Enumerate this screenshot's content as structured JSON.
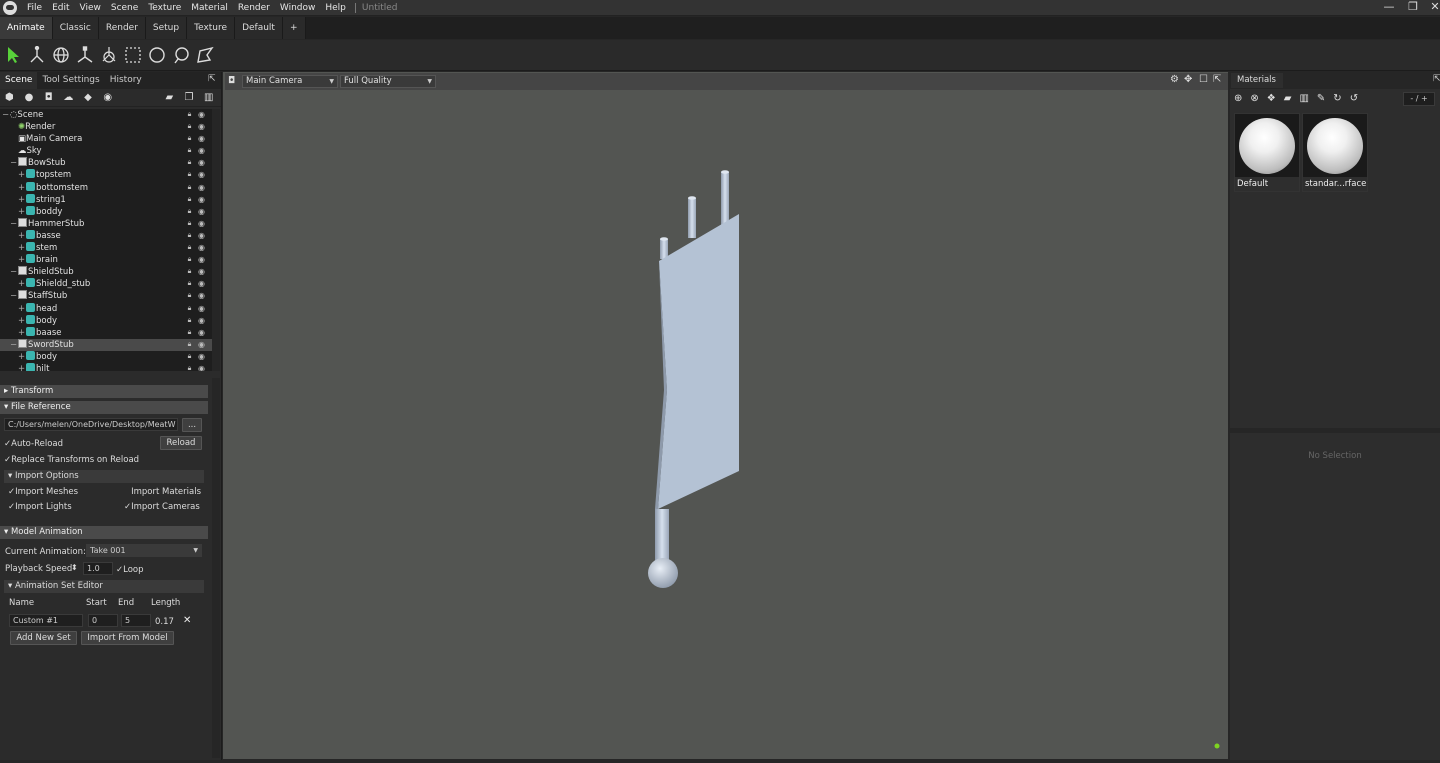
{
  "menu": {
    "items": [
      "File",
      "Edit",
      "View",
      "Scene",
      "Texture",
      "Material",
      "Render",
      "Window",
      "Help"
    ],
    "document_title": "Untitled"
  },
  "window_controls": {
    "minimize": "—",
    "restore": "❐",
    "close": "✕"
  },
  "workspace_tabs": [
    "Animate",
    "Classic",
    "Render",
    "Setup",
    "Texture",
    "Default",
    "+"
  ],
  "left_panel": {
    "tabs": [
      "Scene",
      "Tool Settings",
      "History"
    ],
    "tree": [
      {
        "label": "Scene",
        "icon": "scene",
        "indent": 0,
        "expander": "−"
      },
      {
        "label": "Render",
        "icon": "render",
        "indent": 1,
        "expander": ""
      },
      {
        "label": "Main Camera",
        "icon": "camera",
        "indent": 1,
        "expander": ""
      },
      {
        "label": "Sky",
        "icon": "sky",
        "indent": 1,
        "expander": ""
      },
      {
        "label": "BowStub",
        "icon": "group",
        "indent": 1,
        "expander": "−"
      },
      {
        "label": "topstem",
        "icon": "cube",
        "indent": 2,
        "expander": "+"
      },
      {
        "label": "bottomstem",
        "icon": "cube",
        "indent": 2,
        "expander": "+"
      },
      {
        "label": "string1",
        "icon": "cube",
        "indent": 2,
        "expander": "+"
      },
      {
        "label": "boddy",
        "icon": "cube",
        "indent": 2,
        "expander": "+"
      },
      {
        "label": "HammerStub",
        "icon": "group",
        "indent": 1,
        "expander": "−"
      },
      {
        "label": "basse",
        "icon": "cube",
        "indent": 2,
        "expander": "+"
      },
      {
        "label": "stem",
        "icon": "cube",
        "indent": 2,
        "expander": "+"
      },
      {
        "label": "brain",
        "icon": "cube",
        "indent": 2,
        "expander": "+"
      },
      {
        "label": "ShieldStub",
        "icon": "group",
        "indent": 1,
        "expander": "−"
      },
      {
        "label": "Shieldd_stub",
        "icon": "cube",
        "indent": 2,
        "expander": "+"
      },
      {
        "label": "StaffStub",
        "icon": "group",
        "indent": 1,
        "expander": "−"
      },
      {
        "label": "head",
        "icon": "cube",
        "indent": 2,
        "expander": "+"
      },
      {
        "label": "body",
        "icon": "cube",
        "indent": 2,
        "expander": "+"
      },
      {
        "label": "baase",
        "icon": "cube",
        "indent": 2,
        "expander": "+"
      },
      {
        "label": "SwordStub",
        "icon": "group",
        "indent": 1,
        "expander": "−",
        "selected": true
      },
      {
        "label": "body",
        "icon": "cube",
        "indent": 2,
        "expander": "+"
      },
      {
        "label": "hilt",
        "icon": "cube",
        "indent": 2,
        "expander": "+"
      }
    ],
    "sections": {
      "transform": "Transform",
      "file_reference": "File Reference",
      "import_options": "Import Options",
      "model_animation": "Model Animation",
      "animation_set_editor": "Animation Set Editor"
    },
    "file_reference": {
      "path": "C:/Users/melen/OneDrive/Desktop/MeatW",
      "browse": "...",
      "reload": "Reload",
      "auto_reload": "Auto-Reload",
      "replace_transforms": "Replace Transforms on Reload"
    },
    "import_options": {
      "meshes": "Import Meshes",
      "materials": "Import Materials",
      "lights": "Import Lights",
      "cameras": "Import Cameras"
    },
    "model_animation": {
      "current_label": "Current Animation:",
      "current_value": "Take 001",
      "speed_label": "Playback Speed",
      "speed_value": "1.0",
      "loop": "Loop",
      "headers": [
        "Name",
        "Start",
        "End",
        "Length"
      ],
      "row": {
        "name": "Custom #1",
        "start": "0",
        "end": "5",
        "length": "0.17"
      },
      "add_set": "Add New Set",
      "import_from_model": "Import From Model"
    }
  },
  "viewport": {
    "camera": "Main Camera",
    "quality": "Full Quality"
  },
  "right_panel": {
    "tab": "Materials",
    "page": "- / +",
    "materials": [
      {
        "name": "Default"
      },
      {
        "name": "standar...rface1"
      }
    ],
    "no_selection": "No Selection"
  },
  "colors": {
    "accent_teal": "#3bb5b0",
    "viewport_bg": "#535552",
    "model": "#b4c2d4",
    "status_dot": "#7ed321"
  }
}
